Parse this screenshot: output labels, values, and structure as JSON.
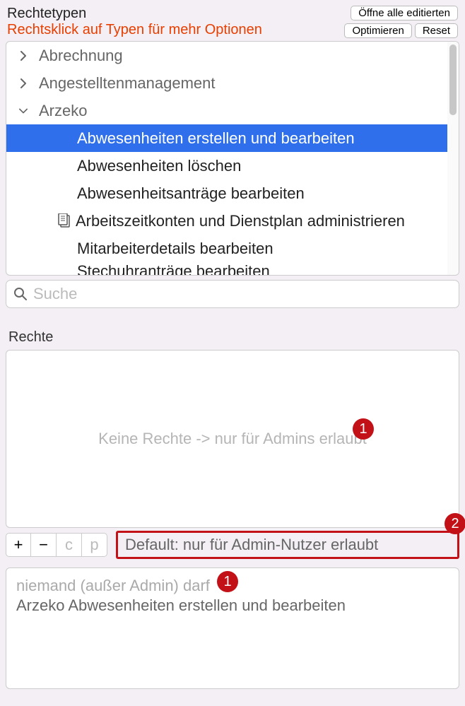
{
  "header": {
    "title": "Rechtetypen",
    "subtitle": "Rechtsklick auf Typen für mehr Optionen",
    "btn_open_all": "Öffne alle editierten",
    "btn_optimize": "Optimieren",
    "btn_reset": "Reset"
  },
  "tree": {
    "groups": [
      {
        "label": "Abrechnung",
        "expanded": false
      },
      {
        "label": "Angestelltenmanagement",
        "expanded": false
      },
      {
        "label": "Arzeko",
        "expanded": true
      }
    ],
    "arzeko_children": [
      {
        "label": "Abwesenheiten erstellen und bearbeiten",
        "selected": true,
        "icon": false
      },
      {
        "label": "Abwesenheiten löschen",
        "selected": false,
        "icon": false
      },
      {
        "label": "Abwesenheitsanträge bearbeiten",
        "selected": false,
        "icon": false
      },
      {
        "label": "Arbeitszeitkonten und Dienstplan administrieren",
        "selected": false,
        "icon": true
      },
      {
        "label": "Mitarbeiterdetails bearbeiten",
        "selected": false,
        "icon": false
      },
      {
        "label": "Stechuhranträge bearbeiten",
        "selected": false,
        "icon": false
      }
    ]
  },
  "search": {
    "placeholder": "Suche"
  },
  "rechte": {
    "section_label": "Rechte",
    "placeholder": "Keine Rechte -> nur für Admins erlaubt",
    "badge1": "1"
  },
  "toolbar": {
    "plus": "+",
    "minus": "−",
    "c": "c",
    "p": "p",
    "default_text": "Default: nur für Admin-Nutzer erlaubt",
    "badge2": "2"
  },
  "summary": {
    "line1": "niemand (außer Admin) darf",
    "line2": "Arzeko Abwesenheiten erstellen und bearbeiten",
    "badge1": "1"
  }
}
